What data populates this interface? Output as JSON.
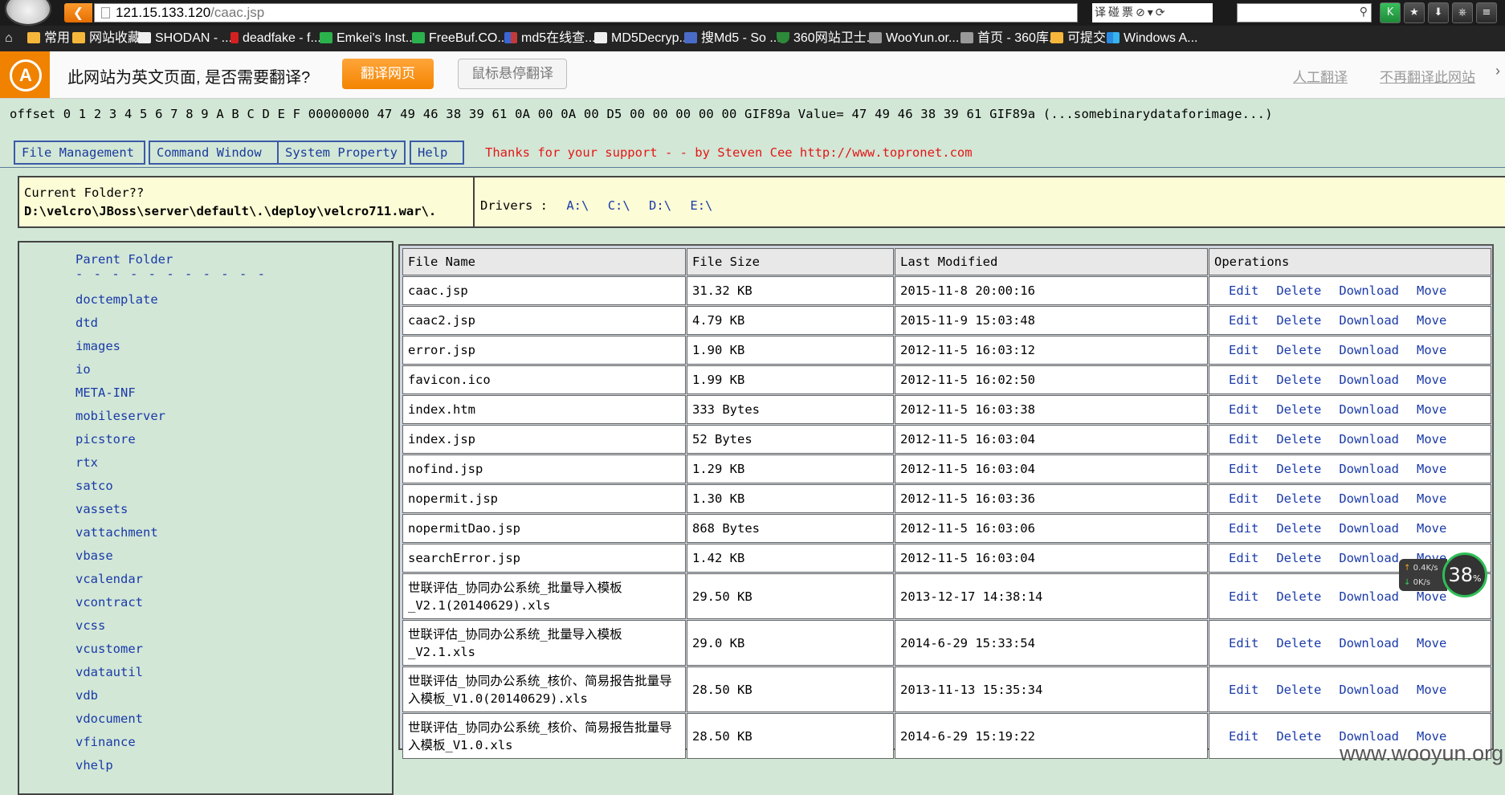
{
  "browser": {
    "url_host": "121.15.133.120",
    "url_path": "/caac.jsp",
    "address_icons": [
      "译",
      "碰",
      "票",
      "⊘",
      "▾",
      "⟳"
    ],
    "bookmarks": [
      {
        "label": "常用",
        "icon": "folder"
      },
      {
        "label": "网站收藏",
        "icon": "folder"
      },
      {
        "label": "SHODAN - ...",
        "icon": "page"
      },
      {
        "label": "deadfake - f...",
        "icon": "red"
      },
      {
        "label": "Emkei's Inst...",
        "icon": "green"
      },
      {
        "label": "FreeBuf.CO...",
        "icon": "green"
      },
      {
        "label": "md5在线查...",
        "icon": "grid"
      },
      {
        "label": "MD5Decryp...",
        "icon": "page"
      },
      {
        "label": "搜Md5 - So ...",
        "icon": "blue"
      },
      {
        "label": "360网站卫士...",
        "icon": "shield"
      },
      {
        "label": "WooYun.or...",
        "icon": "grey"
      },
      {
        "label": "首页 - 360库...",
        "icon": "grey"
      },
      {
        "label": "可提交",
        "icon": "folder"
      },
      {
        "label": "Windows A...",
        "icon": "win"
      }
    ]
  },
  "translate_bar": {
    "message": "此网站为英文页面, 是否需要翻译?",
    "translate_button": "翻译网页",
    "hover_button": "鼠标悬停翻译",
    "manual_link": "人工翻译",
    "never_link": "不再翻译此网站",
    "close": "›"
  },
  "page": {
    "offset_line": "offset 0 1 2 3 4 5 6 7 8 9 A B C D E F 00000000 47 49 46 38 39 61 0A 00 0A 00 D5 00 00 00 00 00 GIF89a Value= 47 49 46 38 39 61 GIF89a (...somebinarydataforimage...)",
    "menu": [
      "File Management",
      "Command Window",
      "System Property",
      "Help"
    ],
    "thanks": "Thanks for your support - - by Steven Cee http://www.topronet.com",
    "current_folder_label": "Current Folder??",
    "current_folder_path": "D:\\velcro\\JBoss\\server\\default\\.\\deploy\\velcro711.war\\.",
    "drivers_label": "Drivers :",
    "drivers": [
      "A:\\",
      "C:\\",
      "D:\\",
      "E:\\"
    ]
  },
  "sidebar": {
    "parent_folder": "Parent Folder",
    "dashes": "- - - - - - - - - - -",
    "folders": [
      "doctemplate",
      "dtd",
      "images",
      "io",
      "META-INF",
      "mobileserver",
      "picstore",
      "rtx",
      "satco",
      "vassets",
      "vattachment",
      "vbase",
      "vcalendar",
      "vcontract",
      "vcss",
      "vcustomer",
      "vdatautil",
      "vdb",
      "vdocument",
      "vfinance",
      "vhelp"
    ]
  },
  "file_table": {
    "headers": [
      "File Name",
      "File Size",
      "Last Modified",
      "Operations"
    ],
    "operations": [
      "Edit",
      "Delete",
      "Download",
      "Move"
    ],
    "rows": [
      {
        "name": "caac.jsp",
        "size": "31.32 KB",
        "modified": "2015-11-8 20:00:16"
      },
      {
        "name": "caac2.jsp",
        "size": "4.79 KB",
        "modified": "2015-11-9 15:03:48"
      },
      {
        "name": "error.jsp",
        "size": "1.90 KB",
        "modified": "2012-11-5 16:03:12"
      },
      {
        "name": "favicon.ico",
        "size": "1.99 KB",
        "modified": "2012-11-5 16:02:50"
      },
      {
        "name": "index.htm",
        "size": "333 Bytes",
        "modified": "2012-11-5 16:03:38"
      },
      {
        "name": "index.jsp",
        "size": "52 Bytes",
        "modified": "2012-11-5 16:03:04"
      },
      {
        "name": "nofind.jsp",
        "size": "1.29 KB",
        "modified": "2012-11-5 16:03:04"
      },
      {
        "name": "nopermit.jsp",
        "size": "1.30 KB",
        "modified": "2012-11-5 16:03:36"
      },
      {
        "name": "nopermitDao.jsp",
        "size": "868 Bytes",
        "modified": "2012-11-5 16:03:06"
      },
      {
        "name": "searchError.jsp",
        "size": "1.42 KB",
        "modified": "2012-11-5 16:03:04"
      },
      {
        "name": "世联评估_协同办公系统_批量导入模板_V2.1(20140629).xls",
        "size": "29.50 KB",
        "modified": "2013-12-17 14:38:14"
      },
      {
        "name": "世联评估_协同办公系统_批量导入模板_V2.1.xls",
        "size": "29.0 KB",
        "modified": "2014-6-29 15:33:54"
      },
      {
        "name": "世联评估_协同办公系统_核价、简易报告批量导入模板_V1.0(20140629).xls",
        "size": "28.50 KB",
        "modified": "2013-11-13 15:35:34"
      },
      {
        "name": "世联评估_协同办公系统_核价、简易报告批量导入模板_V1.0.xls",
        "size": "28.50 KB",
        "modified": "2014-6-29 15:19:22"
      }
    ]
  },
  "speed_widget": {
    "up": "0.4K/s",
    "down": "0K/s",
    "percent": "38",
    "percent_unit": "%"
  },
  "watermark": "www.wooyun.org"
}
